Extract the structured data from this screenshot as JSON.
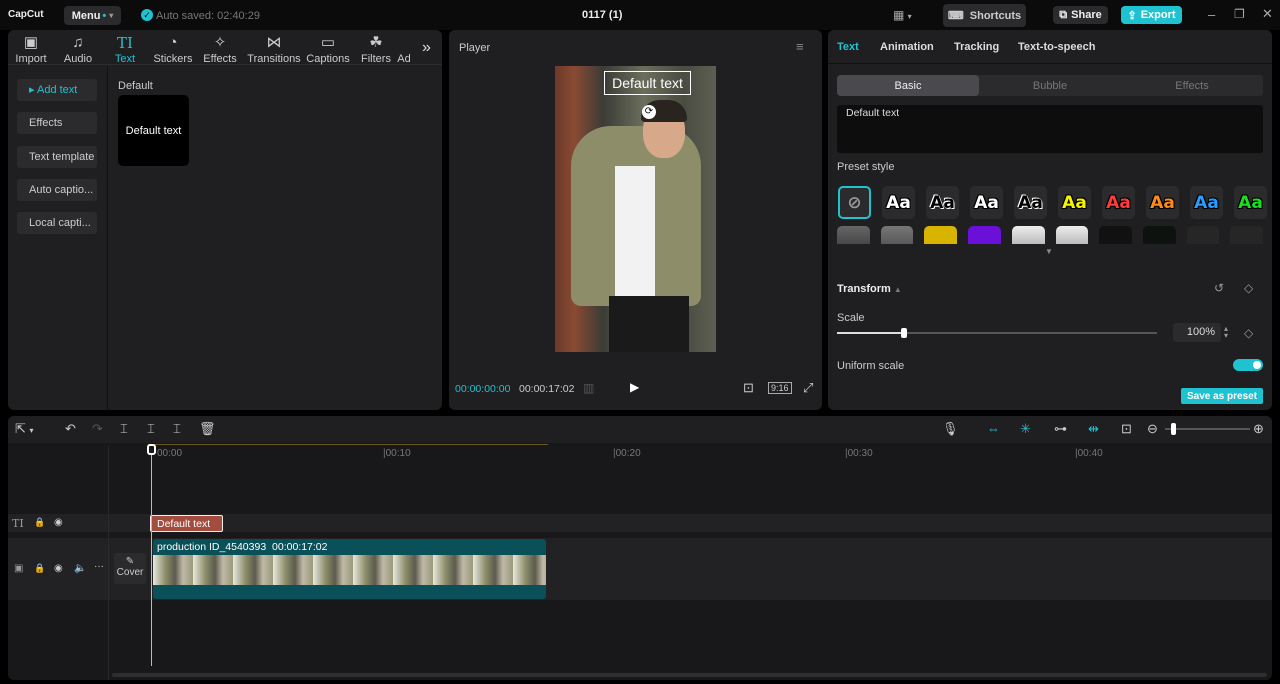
{
  "app": {
    "logo": "CapCut",
    "menu": "Menu",
    "autosave": "Auto saved: 02:40:29",
    "project_title": "0117 (1)",
    "shortcuts": "Shortcuts",
    "share": "Share",
    "export": "Export",
    "accent": "#1fc2d0"
  },
  "media_tabs": [
    {
      "label": "Import",
      "icon": "▣"
    },
    {
      "label": "Audio",
      "icon": "♫"
    },
    {
      "label": "Text",
      "icon": "TI"
    },
    {
      "label": "Stickers",
      "icon": "◔"
    },
    {
      "label": "Effects",
      "icon": "✧"
    },
    {
      "label": "Transitions",
      "icon": "⋈"
    },
    {
      "label": "Captions",
      "icon": "▭"
    },
    {
      "label": "Filters",
      "icon": "☘"
    },
    {
      "label": "Ad",
      "icon": ""
    }
  ],
  "left_sidebar": [
    "Add text",
    "Effects",
    "Text template",
    "Auto captio...",
    "Local capti..."
  ],
  "text_section": {
    "heading": "Default",
    "card": "Default text"
  },
  "player": {
    "title": "Player",
    "overlay_text": "Default text",
    "current_time": "00:00:00:00",
    "total_time": "00:00:17:02",
    "ratio": "9:16"
  },
  "right_panel": {
    "tabs": [
      "Text",
      "Animation",
      "Tracking",
      "Text-to-speech"
    ],
    "subtabs": [
      "Basic",
      "Bubble",
      "Effects"
    ],
    "text_value": "Default text",
    "preset_label": "Preset style",
    "preset_sample": "Aa",
    "preset_colors": [
      "#ffffff",
      "#ffffff",
      "#ffffff",
      "#ffffff",
      "#f5f500",
      "#ff3b3b",
      "#ff8a1a",
      "#2a9bff",
      "#18e020"
    ],
    "transform": "Transform",
    "scale_label": "Scale",
    "scale_value": "100%",
    "scale_fraction": 0.21,
    "uniform_scale": "Uniform scale",
    "uniform_on": true,
    "save_preset": "Save as preset"
  },
  "timeline": {
    "ticks": [
      "00:00",
      "00:10",
      "00:20",
      "00:30",
      "00:40"
    ],
    "text_clip": "Default text",
    "video_clip_name": "production ID_4540393",
    "video_clip_duration": "00:00:17:02",
    "cover": "Cover"
  }
}
